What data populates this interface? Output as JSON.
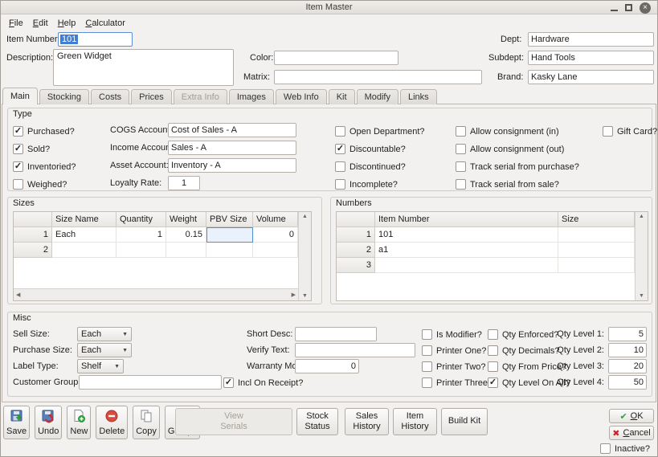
{
  "window": {
    "title": "Item Master",
    "menu": [
      "File",
      "Edit",
      "Help",
      "Calculator"
    ]
  },
  "header": {
    "item_number_label": "Item Number:",
    "item_number_value": "101",
    "description_label": "Description:",
    "description_value": "Green Widget",
    "color_label": "Color:",
    "color_value": "",
    "matrix_label": "Matrix:",
    "matrix_value": "",
    "dept_label": "Dept:",
    "dept_value": "Hardware",
    "subdept_label": "Subdept:",
    "subdept_value": "Hand Tools",
    "brand_label": "Brand:",
    "brand_value": "Kasky Lane"
  },
  "tabs": {
    "items": [
      "Main",
      "Stocking",
      "Costs",
      "Prices",
      "Extra Info",
      "Images",
      "Web Info",
      "Kit",
      "Modify",
      "Links"
    ],
    "active": "Main",
    "disabled": "Extra Info"
  },
  "type_section": {
    "title": "Type",
    "flags_left": [
      {
        "label": "Purchased?",
        "checked": true
      },
      {
        "label": "Sold?",
        "checked": true
      },
      {
        "label": "Inventoried?",
        "checked": true
      },
      {
        "label": "Weighed?",
        "checked": false
      }
    ],
    "fields": [
      {
        "label": "COGS Account:",
        "value": "Cost of Sales - A"
      },
      {
        "label": "Income Account:",
        "value": "Sales - A"
      },
      {
        "label": "Asset Account:",
        "value": "Inventory - A"
      },
      {
        "label": "Loyalty Rate:",
        "value": "1"
      }
    ],
    "flags_mid": [
      {
        "label": "Open Department?",
        "checked": false
      },
      {
        "label": "Discountable?",
        "checked": true
      },
      {
        "label": "Discontinued?",
        "checked": false
      },
      {
        "label": "Incomplete?",
        "checked": false
      }
    ],
    "flags_right": [
      {
        "label": "Allow consignment (in)",
        "checked": false
      },
      {
        "label": "Allow consignment (out)",
        "checked": false
      },
      {
        "label": "Track serial from purchase?",
        "checked": false
      },
      {
        "label": "Track serial from sale?",
        "checked": false
      }
    ],
    "gift_card": {
      "label": "Gift Card?",
      "checked": false
    }
  },
  "sizes_table": {
    "title": "Sizes",
    "columns": [
      "Size Name",
      "Quantity",
      "Weight",
      "PBV Size",
      "Volume"
    ],
    "rows": [
      {
        "num": "1",
        "cells": [
          "Each",
          "1",
          "0.15",
          "",
          "0"
        ]
      },
      {
        "num": "2",
        "cells": [
          "",
          "",
          "",
          "",
          ""
        ]
      }
    ]
  },
  "numbers_table": {
    "title": "Numbers",
    "columns": [
      "Item Number",
      "Size"
    ],
    "rows": [
      {
        "num": "1",
        "cells": [
          "101",
          ""
        ]
      },
      {
        "num": "2",
        "cells": [
          "a1",
          ""
        ]
      },
      {
        "num": "3",
        "cells": [
          "",
          ""
        ]
      }
    ]
  },
  "misc_section": {
    "title": "Misc",
    "sell_size": {
      "label": "Sell Size:",
      "value": "Each"
    },
    "purchase_size": {
      "label": "Purchase Size:",
      "value": "Each"
    },
    "label_type": {
      "label": "Label Type:",
      "value": "Shelf"
    },
    "customer_group": {
      "label": "Customer Group:",
      "value": ""
    },
    "short_desc": {
      "label": "Short Desc:",
      "value": ""
    },
    "verify_text": {
      "label": "Verify Text:",
      "value": ""
    },
    "warranty_months": {
      "label": "Warranty Months:",
      "value": "0"
    },
    "incl_on_receipt": {
      "label": "Incl On Receipt?",
      "checked": true
    },
    "flags_a": [
      {
        "label": "Is Modifier?",
        "checked": false
      },
      {
        "label": "Printer One?",
        "checked": false
      },
      {
        "label": "Printer Two?",
        "checked": false
      },
      {
        "label": "Printer Three?",
        "checked": false
      }
    ],
    "flags_b": [
      {
        "label": "Qty Enforced?",
        "checked": false
      },
      {
        "label": "Qty Decimals?",
        "checked": false
      },
      {
        "label": "Qty From Price?",
        "checked": false
      },
      {
        "label": "Qty Level On All?",
        "checked": true
      }
    ],
    "qty_levels": [
      {
        "label": "Qty Level 1:",
        "value": "5"
      },
      {
        "label": "Qty Level 2:",
        "value": "10"
      },
      {
        "label": "Qty Level 3:",
        "value": "20"
      },
      {
        "label": "Qty Level 4:",
        "value": "50"
      }
    ]
  },
  "toolbar": {
    "icon_buttons": [
      {
        "label": "Save",
        "icon": "save-disk-icon"
      },
      {
        "label": "Undo",
        "icon": "undo-disk-icon"
      },
      {
        "label": "New",
        "icon": "new-page-icon"
      },
      {
        "label": "Delete",
        "icon": "delete-circle-icon"
      },
      {
        "label": "Copy",
        "icon": "copy-pages-icon"
      },
      {
        "label": "Groups",
        "icon": "groups-people-icon"
      }
    ],
    "wide_buttons": [
      {
        "label": "View Serials",
        "disabled": true
      },
      {
        "label": "Stock Status",
        "disabled": false
      },
      {
        "label": "Sales History",
        "disabled": false
      },
      {
        "label": "Item History",
        "disabled": false
      },
      {
        "label": "Build Kit",
        "disabled": false
      }
    ]
  },
  "footer": {
    "ok_label": "OK",
    "cancel_label": "Cancel",
    "inactive": {
      "label": "Inactive?",
      "checked": false
    }
  }
}
